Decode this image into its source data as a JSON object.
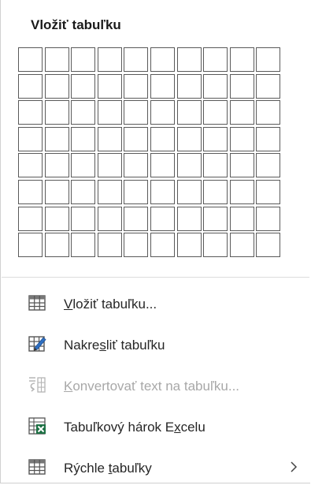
{
  "header": {
    "title": "Vložiť tabuľku"
  },
  "grid": {
    "columns": 10,
    "rows": 8
  },
  "menu": {
    "items": [
      {
        "pre": "",
        "key": "V",
        "post": "ložiť tabuľku...",
        "icon": "table-icon",
        "disabled": false
      },
      {
        "pre": "Nakre",
        "key": "s",
        "post": "liť tabuľku",
        "icon": "draw-table-icon",
        "disabled": false
      },
      {
        "pre": "",
        "key": "K",
        "post": "onvertovať text na tabuľku...",
        "icon": "convert-text-icon",
        "disabled": true
      },
      {
        "pre": "Tabuľkový hárok E",
        "key": "x",
        "post": "celu",
        "icon": "excel-sheet-icon",
        "disabled": false
      },
      {
        "pre": "Rýchle ",
        "key": "t",
        "post": "abuľky",
        "icon": "quick-tables-icon",
        "disabled": false,
        "submenu": true
      }
    ]
  },
  "colors": {
    "gridBorder": "#5a5a5a",
    "excelGreen": "#1e7145",
    "disabledText": "#a8a8a8"
  }
}
